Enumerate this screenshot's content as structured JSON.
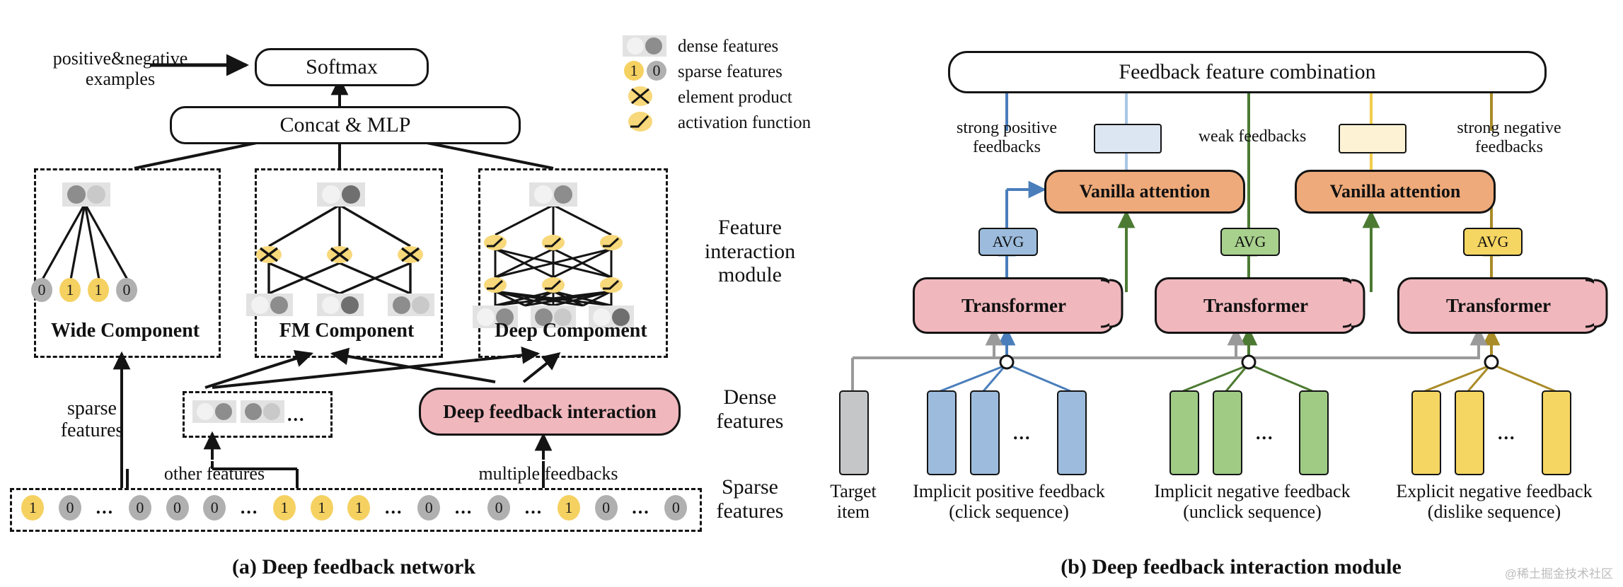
{
  "figure": {
    "caption_a": "(a) Deep feedback network",
    "caption_b": "(b) Deep feedback interaction module",
    "watermark": "@稀土掘金技术社区"
  },
  "panel_a": {
    "softmax_label": "Softmax",
    "concat_label": "Concat & MLP",
    "input_label": "positive&negative\nexamples",
    "deep_feedback_label": "Deep feedback interaction",
    "other_features_label": "other features",
    "multiple_feedbacks_label": "multiple feedbacks",
    "side_labels": {
      "feature_interaction": "Feature\ninteraction\nmodule",
      "dense": "Dense\nfeatures",
      "sparse": "Sparse\nfeatures"
    },
    "left_label_sparse": "sparse\nfeatures",
    "components": [
      {
        "name": "Wide Component",
        "sparse_values": [
          "0",
          "1",
          "1",
          "0"
        ]
      },
      {
        "name": "FM Component"
      },
      {
        "name": "Deep Compoment"
      }
    ],
    "bottom_sparse_sequence": [
      "1",
      "0",
      "...",
      "0",
      "0",
      "0",
      "...",
      "1",
      "1",
      "1",
      "...",
      "0",
      "...",
      "0",
      "...",
      "1",
      "0",
      "...",
      "0"
    ]
  },
  "legend": {
    "items": [
      {
        "icon": "dense-feature-swatch",
        "label": "dense features"
      },
      {
        "icon": "sparse-feature-swatch",
        "label": "sparse features",
        "values": [
          "1",
          "0"
        ]
      },
      {
        "icon": "element-product-icon",
        "label": "element product"
      },
      {
        "icon": "activation-function-icon",
        "label": "activation function"
      }
    ]
  },
  "panel_b": {
    "combination_label": "Feedback feature combination",
    "arrow_labels": {
      "strong_positive": "strong positive\nfeedbacks",
      "weak": "weak feedbacks",
      "strong_negative": "strong negative\nfeedbacks"
    },
    "attention_label": "Vanilla attention",
    "avg_label": "AVG",
    "transformer_label": "Transformer",
    "columns": [
      {
        "title": "Target\nitem",
        "color": "#c4c6c8"
      },
      {
        "title": "Implicit positive feedback\n(click sequence)",
        "color": "#9dbcdd"
      },
      {
        "title": "Implicit negative feedback\n(unclick sequence)",
        "color": "#9fcb85"
      },
      {
        "title": "Explicit negative feedback\n(dislike sequence)",
        "color": "#f6d662"
      }
    ],
    "ellipsis": "..."
  },
  "colors": {
    "accent_yellow": "#f5d161",
    "gray_dot": "#808080",
    "light_dot": "#f0f0f0",
    "transformer_pink": "#f0b7bd",
    "attention_orange": "#eeaa7a",
    "blue": "#4a7ebb",
    "light_blue": "#a8c6e5",
    "green": "#4c7a32",
    "yellow_line": "#f2cd4b",
    "dark_yellow": "#a98b28",
    "gray_line": "#9a9a9a"
  }
}
